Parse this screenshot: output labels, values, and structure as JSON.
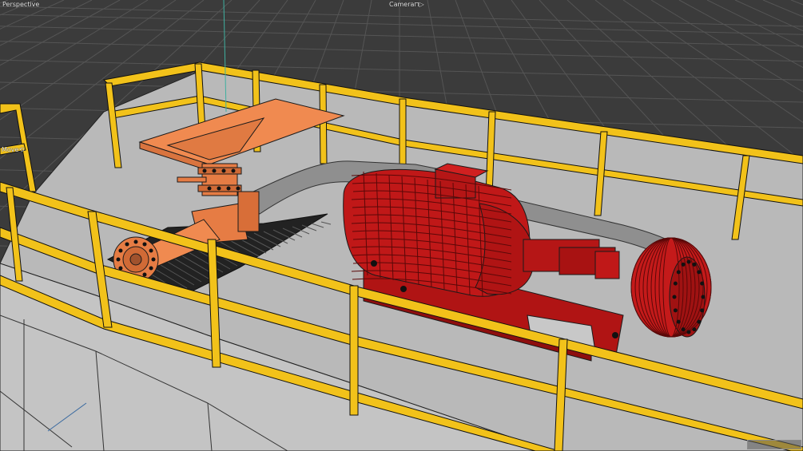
{
  "viewport": {
    "view_name": "Perspective",
    "camera_name": "Camera",
    "camera_glyph": "⊓▷",
    "gizmo_label": "Move",
    "gizmo_glyph": "⟲",
    "status_text": ""
  },
  "colors": {
    "background": "#3b3b3b",
    "grid": "#555555",
    "floor": "#b8b8b8",
    "railing": "#f2c21a",
    "mixer_hopper": "#f08a50",
    "pump_motor": "#c01818",
    "pipe": "#8e8e8e",
    "grating": "#1e1e1e",
    "outline": "#141414"
  }
}
